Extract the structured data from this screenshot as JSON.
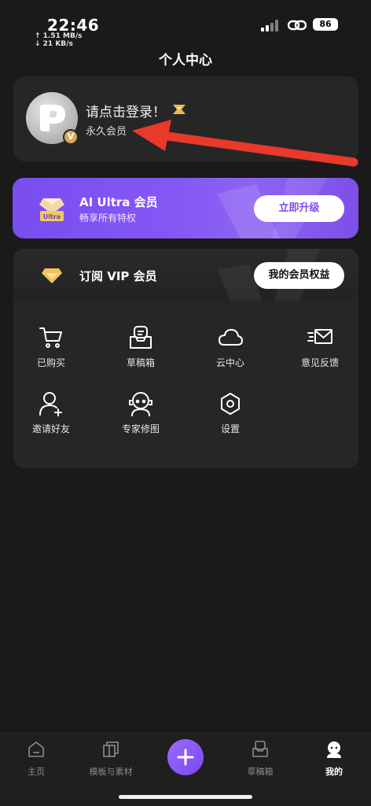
{
  "status_bar": {
    "time": "22:46",
    "upload_speed": "↑ 1.51 MB/s",
    "download_speed": "↓ 21 KB/s",
    "battery": "86"
  },
  "header": {
    "title": "个人中心"
  },
  "profile": {
    "login_prompt": "请点击登录！",
    "member_status": "永久会员",
    "badge": "V"
  },
  "ultra": {
    "title": "AI Ultra 会员",
    "subtitle": "畅享所有特权",
    "badge_text": "Ultra",
    "button": "立即升级"
  },
  "vip": {
    "title": "订阅 VIP 会员",
    "button": "我的会员权益"
  },
  "menu": {
    "items": [
      {
        "label": "已购买",
        "icon": "cart-icon"
      },
      {
        "label": "草稿箱",
        "icon": "draft-box-icon"
      },
      {
        "label": "云中心",
        "icon": "cloud-icon"
      },
      {
        "label": "意见反馈",
        "icon": "mail-icon"
      },
      {
        "label": "邀请好友",
        "icon": "add-user-icon"
      },
      {
        "label": "专家修图",
        "icon": "expert-icon"
      },
      {
        "label": "设置",
        "icon": "settings-icon"
      }
    ]
  },
  "nav": {
    "items": [
      {
        "label": "主页",
        "icon": "home-icon"
      },
      {
        "label": "模板与素材",
        "icon": "template-icon"
      },
      {
        "label": "草稿箱",
        "icon": "draft-box-icon"
      },
      {
        "label": "我的",
        "icon": "profile-icon"
      }
    ],
    "active": "我的"
  },
  "colors": {
    "background": "#1a1a1a",
    "card": "#262626",
    "accent_purple": "#7a4df0",
    "annotation_red": "#e8392b",
    "gold": "#d9a95a"
  }
}
